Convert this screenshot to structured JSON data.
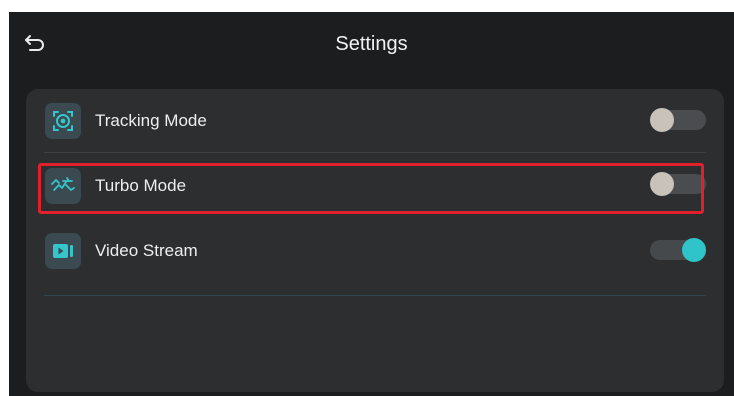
{
  "header": {
    "title": "Settings",
    "back_icon": "back-arrow-icon"
  },
  "settings": {
    "items": [
      {
        "label": "Tracking Mode",
        "icon": "tracking-target-icon",
        "enabled": false
      },
      {
        "label": "Turbo Mode",
        "icon": "turbo-speed-icon",
        "enabled": false,
        "highlighted": true
      },
      {
        "label": "Video Stream",
        "icon": "video-camera-icon",
        "enabled": true
      }
    ]
  },
  "colors": {
    "background": "#1c1d1e",
    "panel": "#2c2e30",
    "accent": "#2ec4c9",
    "icon_tile": "#3a4a50",
    "highlight": "#e0202a",
    "toggle_off_knob": "#c9c2bb"
  }
}
